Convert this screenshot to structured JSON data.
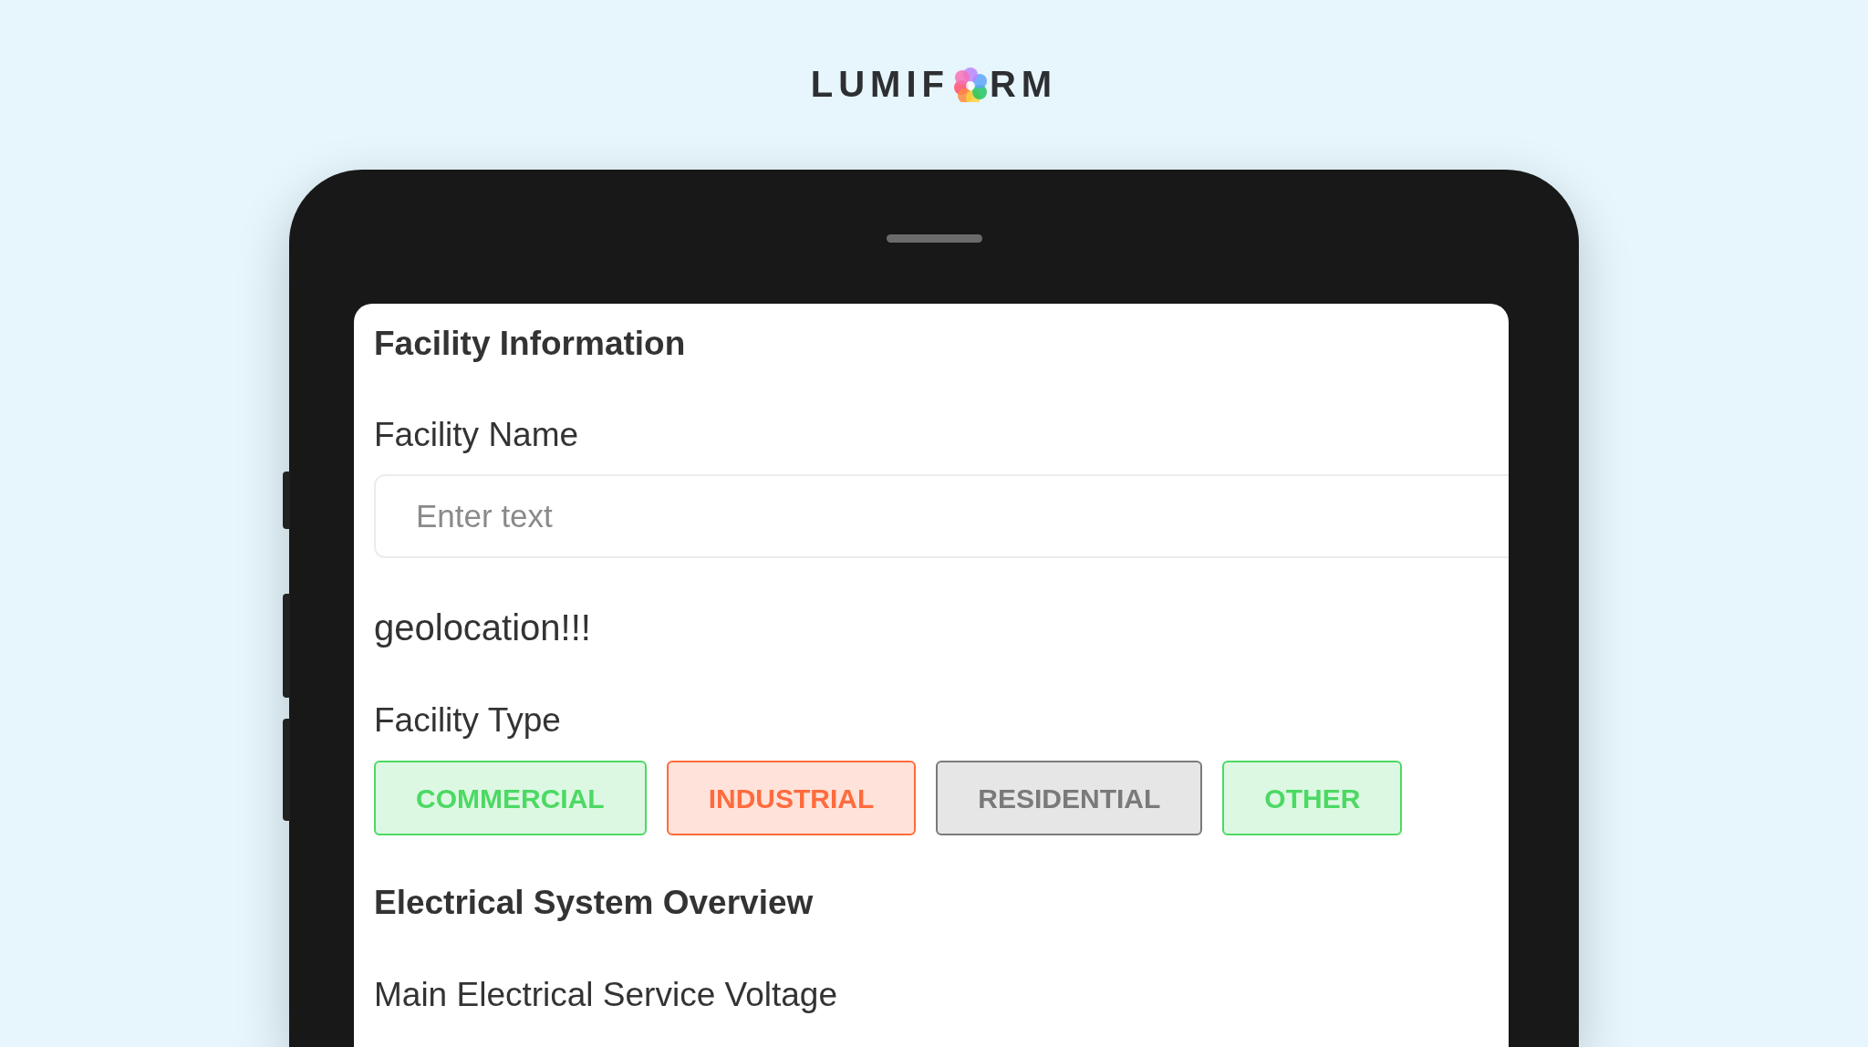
{
  "logo": {
    "left": "LUMIF",
    "right": "RM"
  },
  "form": {
    "section_title": "Facility Information",
    "facility_name": {
      "label": "Facility Name",
      "placeholder": "Enter text"
    },
    "geolocation_label": "geolocation!!!",
    "facility_type": {
      "label": "Facility Type",
      "options": [
        {
          "label": "COMMERCIAL",
          "color": "#4cd964"
        },
        {
          "label": "INDUSTRIAL",
          "color": "#ff6b3d"
        },
        {
          "label": "RESIDENTIAL",
          "color": "#7a7a7a"
        },
        {
          "label": "OTHER",
          "color": "#4cd964"
        }
      ]
    },
    "section_title_2": "Electrical System Overview",
    "voltage_label": "Main Electrical Service Voltage"
  }
}
